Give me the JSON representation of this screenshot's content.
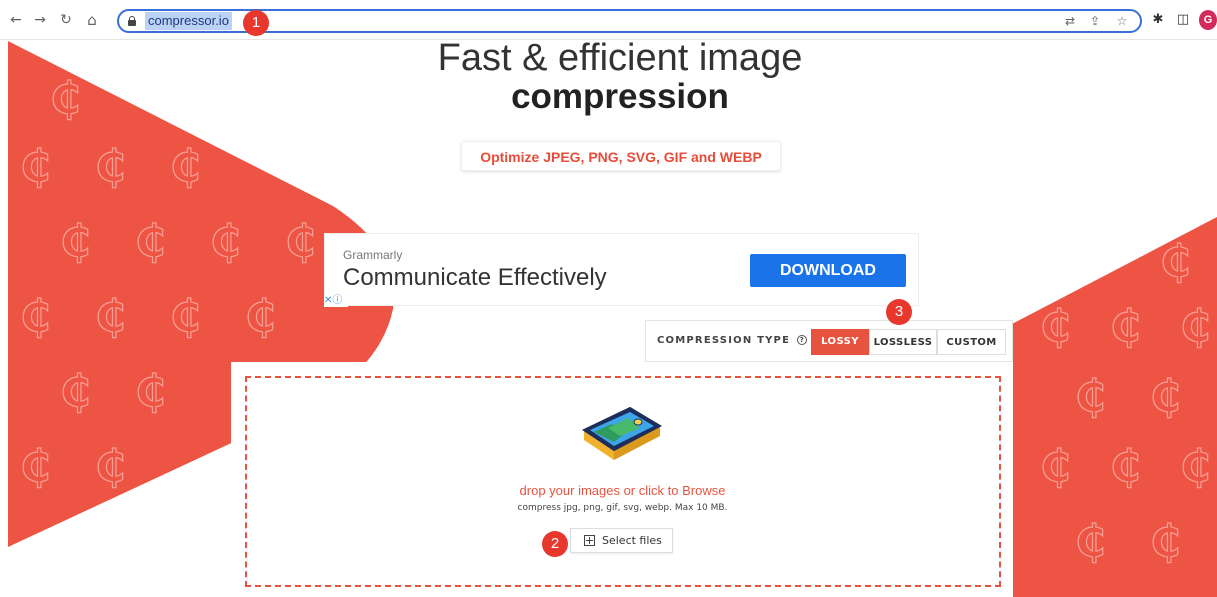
{
  "browser": {
    "url": "compressor.io",
    "profile_initial": "G",
    "icons": [
      "back-icon",
      "forward-icon",
      "reload-icon",
      "home-icon",
      "lock-icon",
      "translate-icon",
      "share-icon",
      "star-icon",
      "extensions-icon",
      "side-panel-icon"
    ]
  },
  "annotations": {
    "m1": "1",
    "m2": "2",
    "m3": "3"
  },
  "hero": {
    "line1": "Fast & efficient image",
    "line2": "compression",
    "subtitle": "Optimize JPEG, PNG, SVG, GIF and WEBP"
  },
  "ad": {
    "brand": "Grammarly",
    "headline": "Communicate Effectively",
    "cta": "DOWNLOAD"
  },
  "compression": {
    "label": "COMPRESSION TYPE",
    "help_symbol": "?",
    "separator": ":",
    "options": [
      "LOSSY",
      "LOSSLESS",
      "CUSTOM"
    ],
    "selected": "LOSSY"
  },
  "dropzone": {
    "title": "drop your images or click to Browse",
    "hint": "compress jpg, png, gif, svg, webp. Max 10 MB.",
    "button": "Select files"
  },
  "colors": {
    "brand": "#e8533f",
    "cta_blue": "#1a73e8",
    "omnibox_focus": "#3a6fd8"
  }
}
